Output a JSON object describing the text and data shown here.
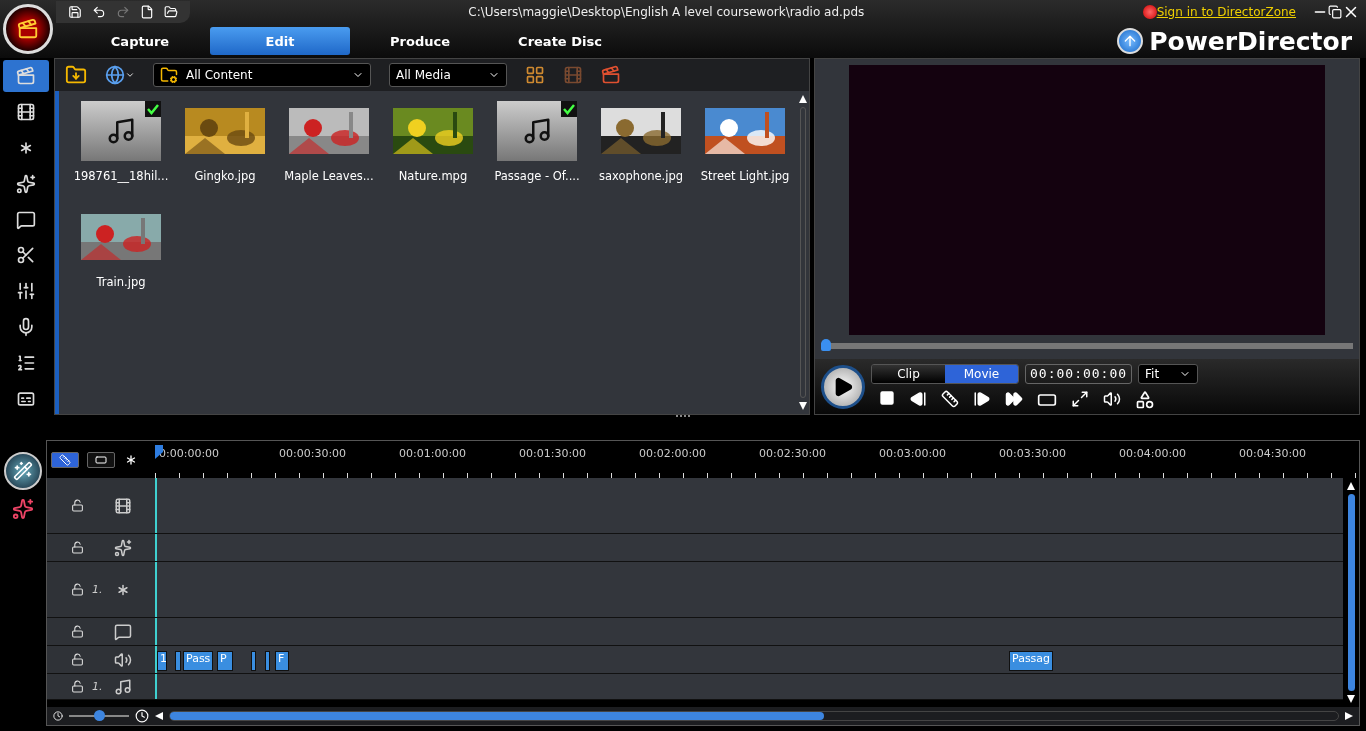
{
  "window": {
    "title": "C:\\Users\\maggie\\Desktop\\English A level coursework\\radio ad.pds",
    "sign_in_link": "Sign in to DirectorZone",
    "brand": "PowerDirector"
  },
  "tabs": [
    {
      "label": "Capture",
      "selected": false
    },
    {
      "label": "Edit",
      "selected": true
    },
    {
      "label": "Produce",
      "selected": false
    },
    {
      "label": "Create Disc",
      "selected": false
    }
  ],
  "sidebar": {
    "items": [
      {
        "kind": "media",
        "selected": true
      },
      {
        "kind": "effect",
        "selected": false
      },
      {
        "kind": "pip",
        "selected": false
      },
      {
        "kind": "particle",
        "selected": false
      },
      {
        "kind": "title",
        "selected": false
      },
      {
        "kind": "transition",
        "selected": false
      },
      {
        "kind": "mixer",
        "selected": false
      },
      {
        "kind": "voice",
        "selected": false
      },
      {
        "kind": "chapter",
        "selected": false
      },
      {
        "kind": "subtitle",
        "selected": false
      }
    ]
  },
  "library": {
    "content_filter": "All Content",
    "media_filter": "All Media",
    "items": [
      {
        "name": "198761__18hil...",
        "kind": "audio",
        "in_use": true
      },
      {
        "name": "Gingko.jpg",
        "in_use": false
      },
      {
        "name": "Maple Leaves...",
        "in_use": false
      },
      {
        "name": "Nature.mpg",
        "kind": "video",
        "in_use": false
      },
      {
        "name": "Passage - Of....",
        "kind": "audio",
        "in_use": true
      },
      {
        "name": "saxophone.jpg",
        "in_use": false
      },
      {
        "name": "Street Light.jpg",
        "in_use": false
      },
      {
        "name": "Train.jpg",
        "in_use": false
      }
    ]
  },
  "preview": {
    "scrub": {
      "level": 0
    },
    "modes": [
      {
        "label": "Clip",
        "selected": false
      },
      {
        "label": "Movie",
        "selected": true
      }
    ],
    "timecode": "00:00:00:00",
    "fit": "Fit"
  },
  "timeline": {
    "view_modes": [
      {
        "kind": "timeline",
        "selected": true
      },
      {
        "kind": "storyboard",
        "selected": false
      }
    ],
    "ruler": [
      "0:00:00:00",
      "00:00:30:00",
      "00:01:00:00",
      "00:01:30:00",
      "00:02:00:00",
      "00:02:30:00",
      "00:03:00:00",
      "00:03:30:00",
      "00:04:00:00",
      "00:04:30:00"
    ],
    "tracks": [
      {
        "kind": "video",
        "locked": false
      },
      {
        "kind": "effect",
        "locked": false
      },
      {
        "kind": "pip",
        "locked": false,
        "number": "1."
      },
      {
        "kind": "title",
        "locked": false
      },
      {
        "kind": "voice",
        "locked": false,
        "clips": [
          {
            "kind": "audio",
            "label": "1"
          },
          {
            "kind": "audio"
          },
          {
            "kind": "audio",
            "label": "Pass"
          },
          {
            "kind": "audio",
            "label": "P"
          },
          {
            "kind": "audio"
          },
          {
            "kind": "audio"
          },
          {
            "kind": "audio",
            "label": "F"
          },
          {
            "kind": "audio",
            "label": "Passag"
          }
        ]
      },
      {
        "kind": "music",
        "locked": false,
        "number": "1."
      }
    ],
    "zoom": {
      "level": 0.5
    }
  }
}
